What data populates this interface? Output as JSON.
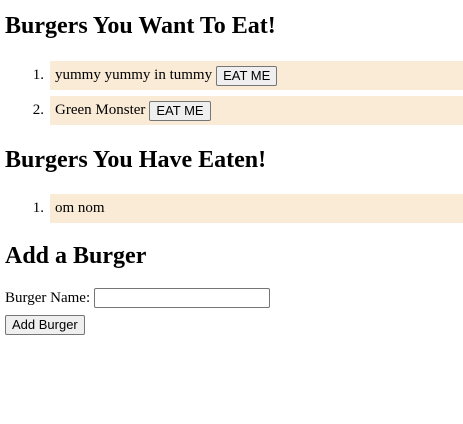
{
  "want": {
    "heading": "Burgers You Want To Eat!",
    "items": [
      {
        "number": "1.",
        "name": "yummy yummy in tummy",
        "button_label": "EAT ME"
      },
      {
        "number": "2.",
        "name": "Green Monster",
        "button_label": "EAT ME"
      }
    ]
  },
  "eaten": {
    "heading": "Burgers You Have Eaten!",
    "items": [
      {
        "number": "1.",
        "name": "om nom"
      }
    ]
  },
  "add": {
    "heading": "Add a Burger",
    "name_label": "Burger Name:",
    "name_value": "",
    "name_placeholder": "",
    "submit_label": "Add Burger"
  },
  "colors": {
    "item_background": "#faebd7"
  }
}
